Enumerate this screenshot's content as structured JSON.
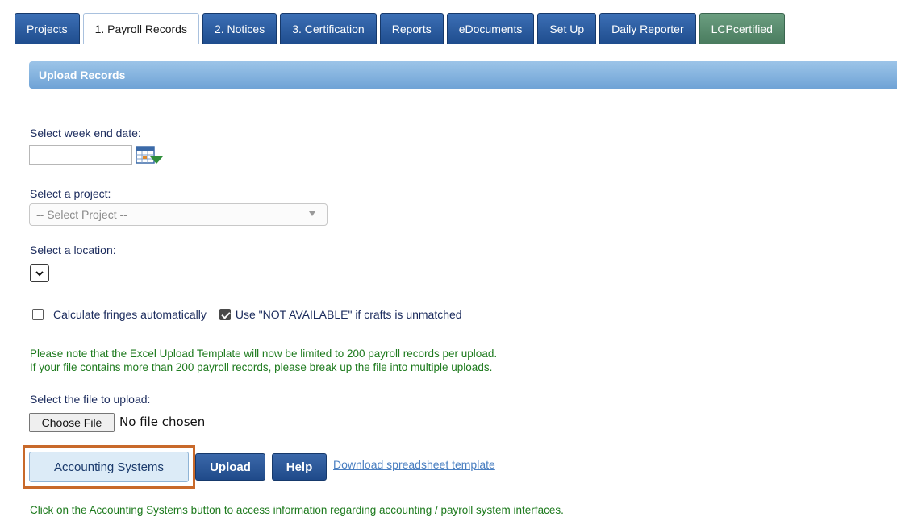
{
  "tabs": [
    {
      "label": "Projects"
    },
    {
      "label": "1. Payroll Records"
    },
    {
      "label": "2. Notices"
    },
    {
      "label": "3. Certification"
    },
    {
      "label": "Reports"
    },
    {
      "label": "eDocuments"
    },
    {
      "label": "Set Up"
    },
    {
      "label": "Daily Reporter"
    },
    {
      "label": "LCPcertified"
    }
  ],
  "section": {
    "title": "Upload Records"
  },
  "form": {
    "week_end_label": "Select week end date:",
    "week_end_value": "",
    "project_label": "Select a project:",
    "project_selected": "-- Select Project --",
    "location_label": "Select a location:",
    "location_selected": "",
    "calc_fringes_label": "Calculate fringes automatically",
    "calc_fringes_checked": false,
    "not_available_label": "Use \"NOT AVAILABLE\" if crafts is unmatched",
    "not_available_checked": true,
    "note_line1": "Please note that the Excel Upload Template will now be limited to 200 payroll records per upload.",
    "note_line2": "If your file contains more than 200 payroll records, please break up the file into multiple uploads.",
    "file_label": "Select the file to upload:",
    "choose_file_label": "Choose File",
    "no_file_text": "No file chosen"
  },
  "actions": {
    "accounting_label": "Accounting Systems",
    "upload_label": "Upload",
    "help_label": "Help",
    "download_link": "Download spreadsheet template"
  },
  "footer": {
    "note": "Click on the Accounting Systems button to access information regarding accounting / payroll system interfaces."
  },
  "colors": {
    "tab_blue": "#2b5da0",
    "tab_green": "#4a7c5f",
    "note_green": "#1d7a1d",
    "highlight": "#c8692a"
  }
}
